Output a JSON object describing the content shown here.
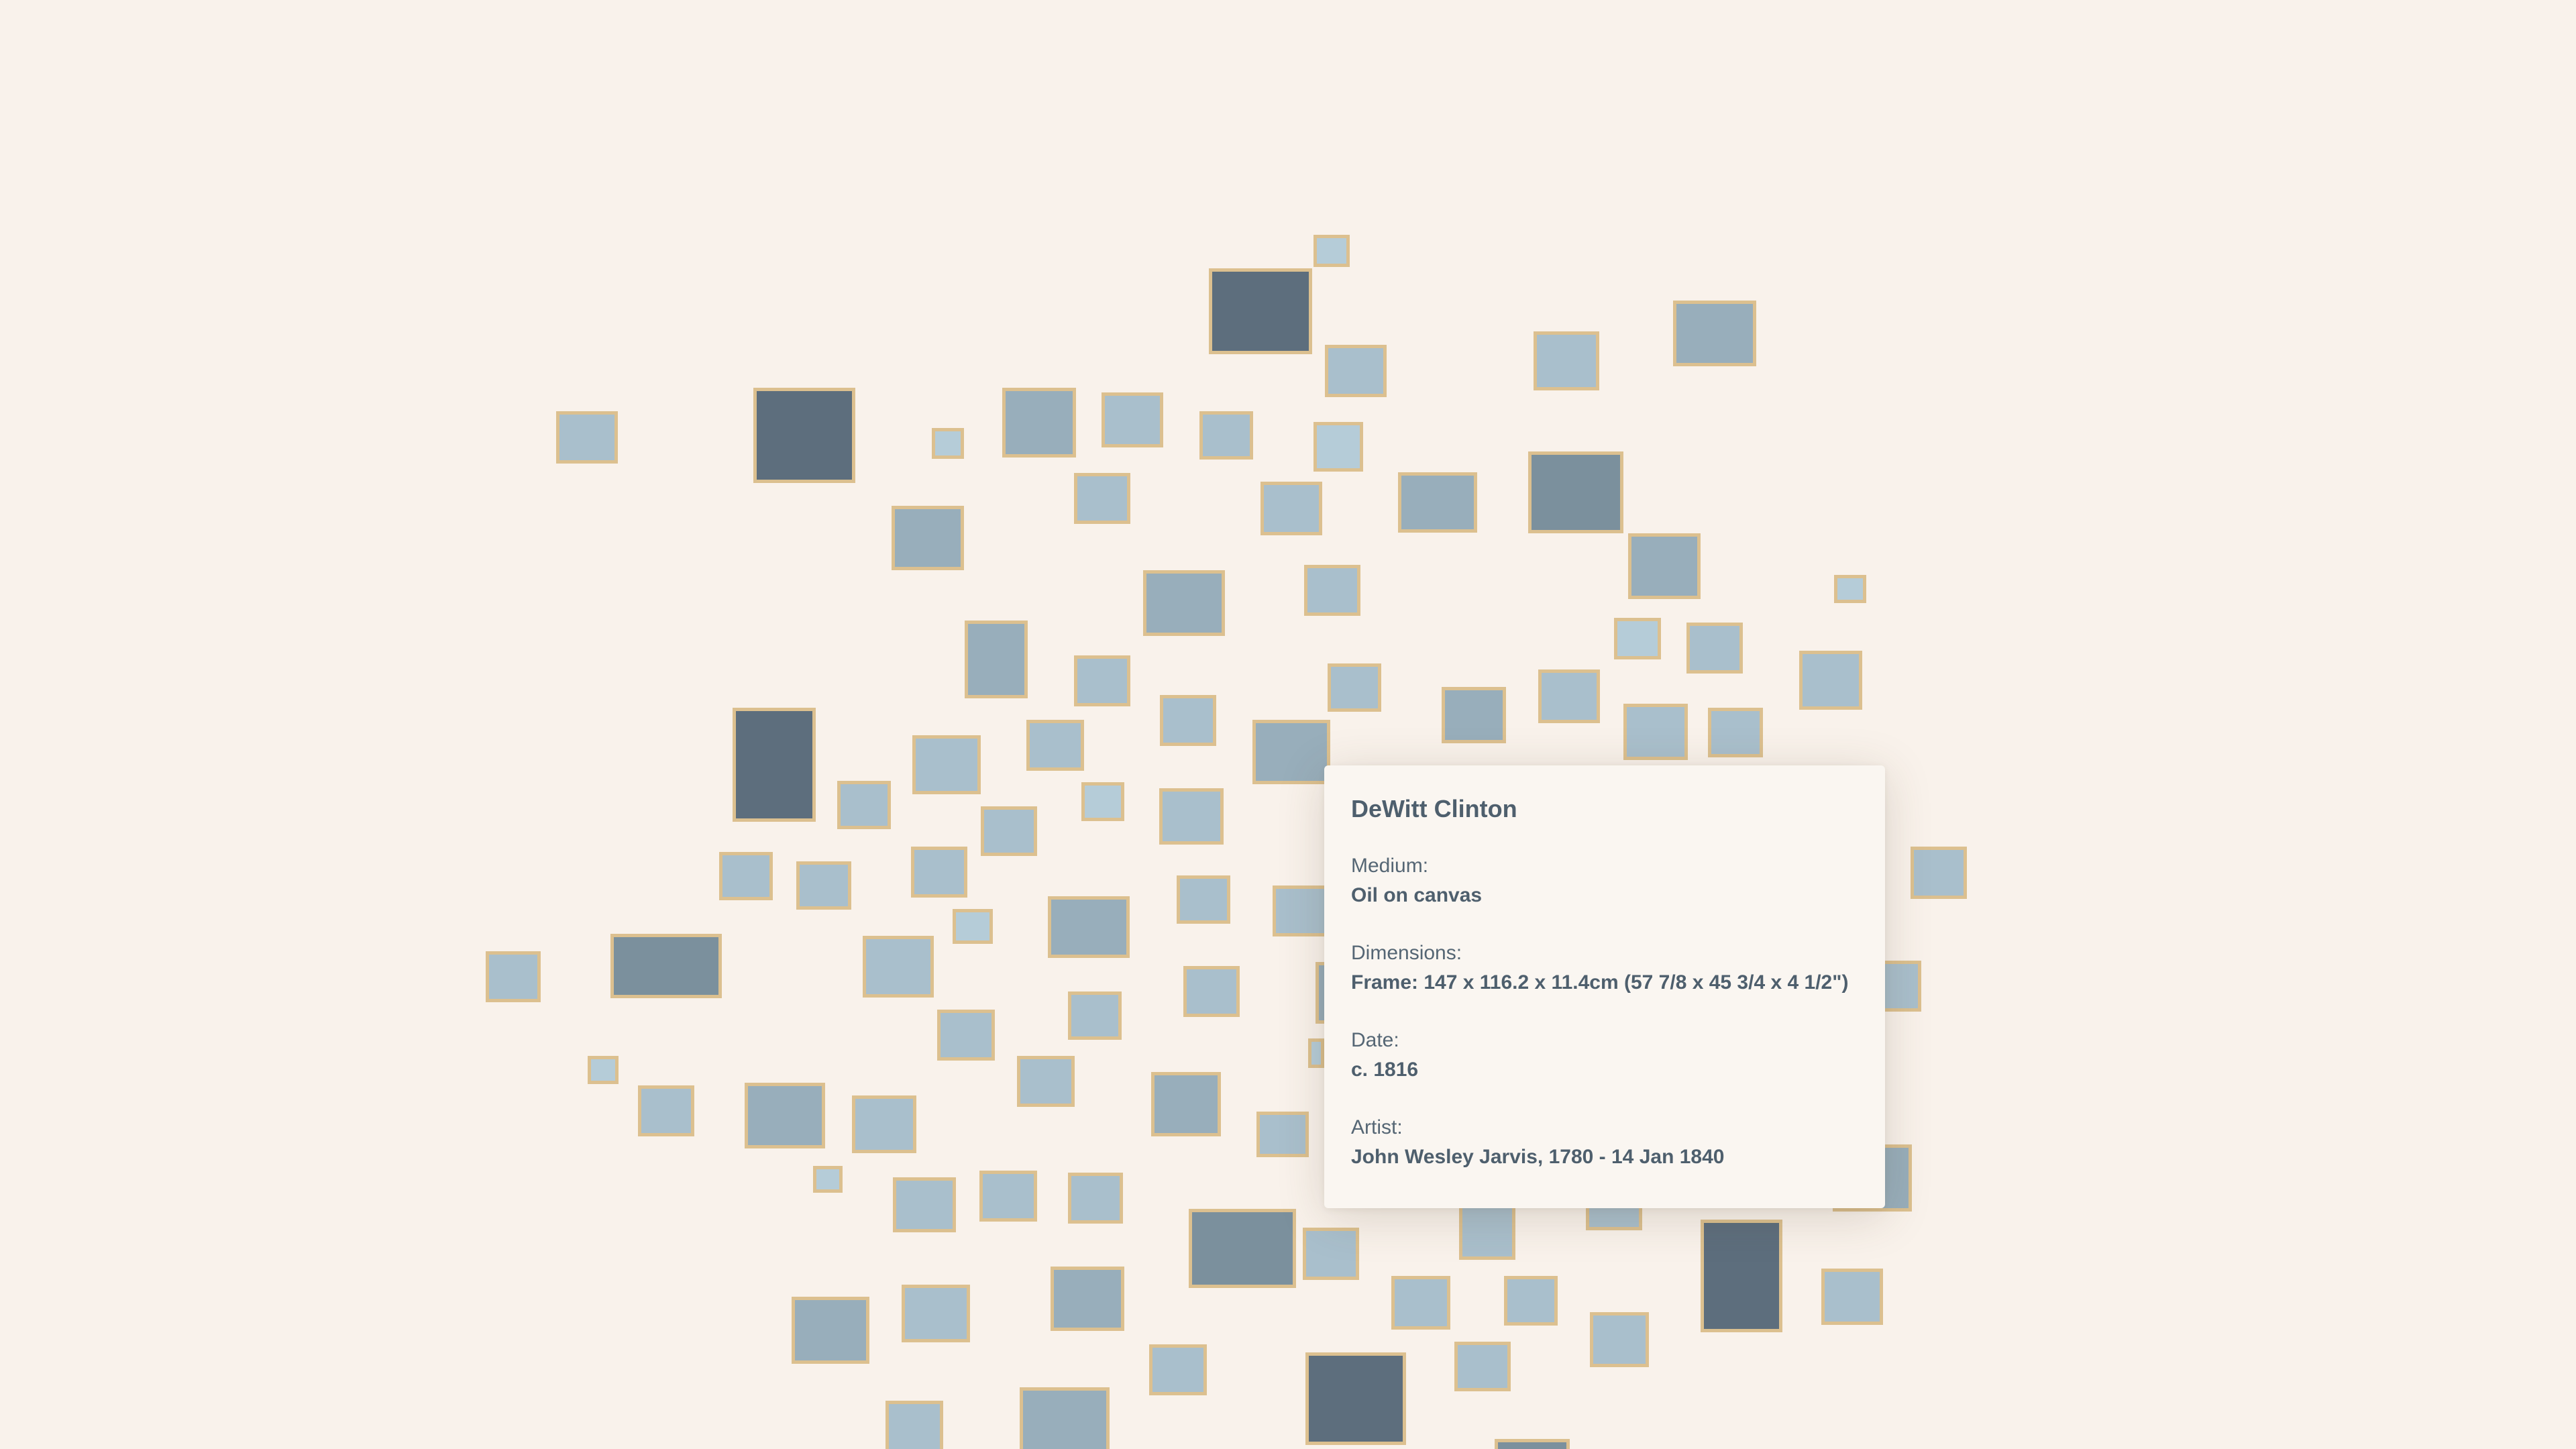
{
  "colors": {
    "background": "#f9f2eb",
    "frame": "#dcc08f",
    "tones": [
      "#b5ccd8",
      "#a9bfcc",
      "#98aebb",
      "#7b909d",
      "#5d6e7d"
    ]
  },
  "tooltip": {
    "title": "DeWitt Clinton",
    "medium_label": "Medium:",
    "medium": "Oil on canvas",
    "dimensions_label": "Dimensions:",
    "dimensions": "Frame: 147 x 116.2 x 11.4cm (57 7/8 x 45 3/4 x 4 1/2\")",
    "date_label": "Date:",
    "date": "c. 1816",
    "artist_label": "Artist:",
    "artist": "John Wesley Jarvis, 1780 - 14 Jan 1840"
  }
}
